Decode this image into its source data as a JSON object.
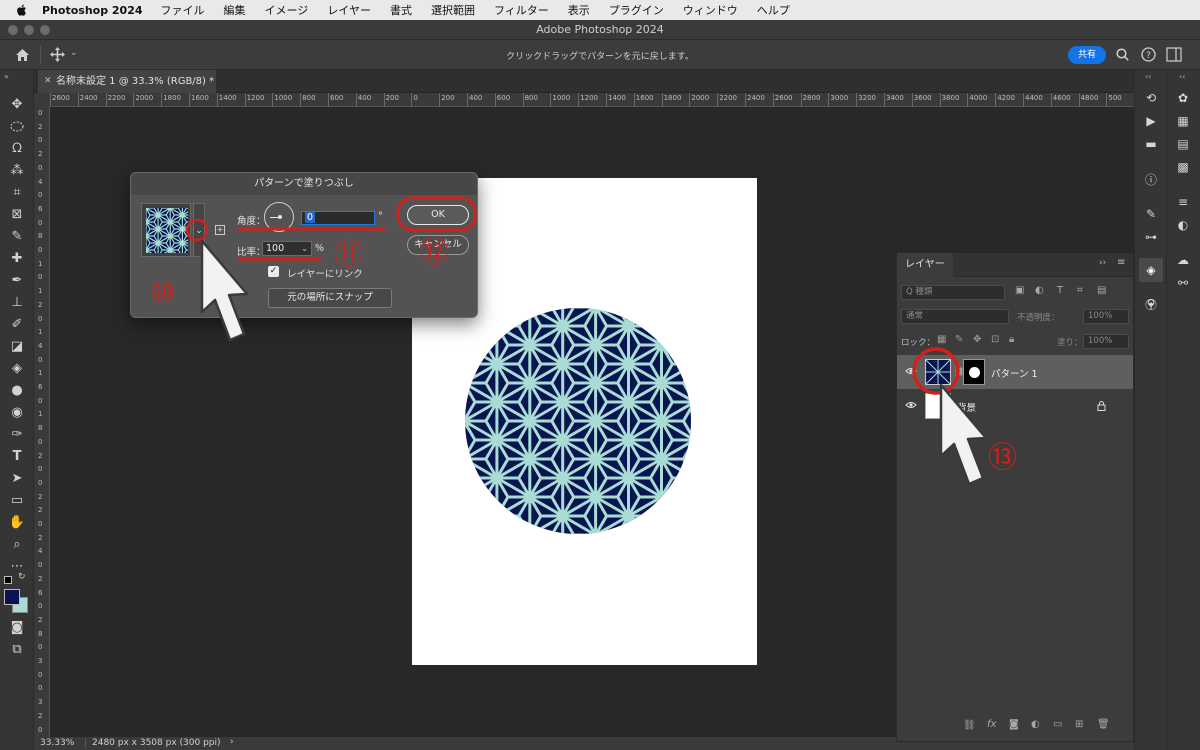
{
  "menubar": {
    "items": [
      "Photoshop 2024",
      "ファイル",
      "編集",
      "イメージ",
      "レイヤー",
      "書式",
      "選択範囲",
      "フィルター",
      "表示",
      "プラグイン",
      "ウィンドウ",
      "ヘルプ"
    ]
  },
  "window": {
    "title": "Adobe Photoshop 2024"
  },
  "options_bar": {
    "hint": "クリックドラッグでパターンを元に戻します。",
    "share_label": "共有"
  },
  "document": {
    "tab_title": "名称未設定 1 @ 33.3% (RGB/8) *"
  },
  "ruler": {
    "h_ticks": [
      "2600",
      "2400",
      "2200",
      "2000",
      "1800",
      "1600",
      "1400",
      "1200",
      "1000",
      "800",
      "600",
      "400",
      "200",
      "0",
      "200",
      "400",
      "600",
      "800",
      "1000",
      "1200",
      "1400",
      "1600",
      "1800",
      "2000",
      "2200",
      "2400",
      "2600",
      "2800",
      "3000",
      "3200",
      "3400",
      "3600",
      "3800",
      "4000",
      "4200",
      "4400",
      "4600",
      "4800",
      "500"
    ],
    "v_ticks": [
      "0",
      "2",
      "0",
      "2",
      "0",
      "4",
      "0",
      "6",
      "0",
      "8",
      "0",
      "1",
      "0",
      "1",
      "2",
      "0",
      "1",
      "4",
      "0",
      "1",
      "6",
      "0",
      "1",
      "8",
      "0",
      "2",
      "0",
      "0",
      "2",
      "2",
      "0",
      "2",
      "4",
      "0",
      "2",
      "6",
      "0",
      "2",
      "8",
      "0",
      "3",
      "0",
      "0",
      "3",
      "2",
      "0"
    ]
  },
  "status": {
    "zoom": "33.33%",
    "doc_info": "2480 px x 3508 px (300 ppi)"
  },
  "dialog": {
    "title": "パターンで塗りつぶし",
    "angle_label": "角度：",
    "angle_value": "0",
    "angle_unit": "°",
    "scale_label": "比率：",
    "scale_value": "100",
    "scale_unit": "%",
    "link_label": "レイヤーにリンク",
    "link_checked": true,
    "snap_button": "元の場所にスナップ",
    "ok_button": "OK",
    "cancel_button": "キャンセル"
  },
  "layers_panel": {
    "tab": "レイヤー",
    "filter_placeholder": "Q 種類",
    "blend_mode": "通常",
    "opacity_label": "不透明度：",
    "opacity_value": "100%",
    "lock_label": "ロック：",
    "fill_label": "塗り：",
    "fill_value": "100%",
    "layers": [
      {
        "name": "パターン 1",
        "selected": true
      },
      {
        "name": "背景",
        "locked": true
      }
    ]
  },
  "annotations": {
    "n10": "⑩",
    "n11": "⑪",
    "n12": "⑫",
    "n13": "⑬"
  },
  "colors": {
    "pattern_bg": "#0a1450",
    "pattern_line": "#a8dcd4",
    "annotation_red": "#d0211c",
    "accent_blue": "#1473e6"
  },
  "icons": [
    "apple-icon",
    "home-icon",
    "move-icon",
    "search-icon",
    "help-icon",
    "panel-icon",
    "eye-icon",
    "lock-icon",
    "link-icon",
    "fx-icon",
    "mask-icon",
    "adjustment-icon",
    "group-icon",
    "new-layer-icon",
    "trash-icon"
  ]
}
